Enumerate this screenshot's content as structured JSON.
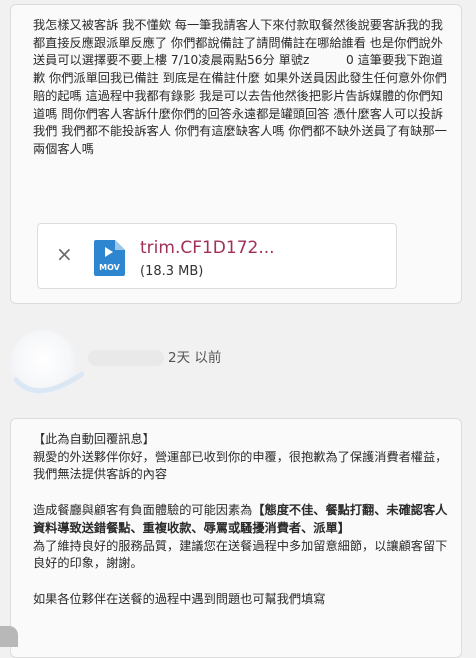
{
  "message": {
    "body": "我怎樣又被客訴 我不懂欸 每一筆我請客人下來付款取餐然後說要客訴我的我都直接反應跟派單反應了 你們都說備註了請問備註在哪給誰看 也是你們說外送員可以選擇要不要上樓 7/10凌晨兩點56分 單號z　　　0 這筆要我下跑道歉 你們派單回我已備註 到底是在備註什麼 如果外送員因此發生任何意外你們賠的起嗎 這過程中我都有錄影 我是可以去告他然後把影片告訴媒體的你們知道嗎 問你們客人客訴什麼你們的回答永遠都是罐頭回答 憑什麼客人可以投訴我們 我們都不能投訴客人 你們有這麼缺客人嗎 你們都不缺外送員了有缺那一兩個客人嗎"
  },
  "attachment": {
    "remove_glyph": "×",
    "file_icon_label": "MOV",
    "file_name": "trim.CF1D172...",
    "file_size": "(18.3 MB)"
  },
  "reply": {
    "time": "2天 以前",
    "auto_reply_tag": "【此為自動回覆訊息】",
    "greeting": "親愛的外送夥伴你好，營運部已收到你的申覆，很抱歉為了保護消費者權益，我們無法提供客訴的內容",
    "factors_intro": "造成餐廳與顧客有負面體驗的可能因素為",
    "factors": "【態度不佳、餐點打翻、未確認客人資料導致送錯餐點、重複收款、辱罵或騷擾消費者、派單】",
    "advice": "為了維持良好的服務品質，建議您在送餐過程中多加留意細節，以讓顧客留下良好的印象，謝謝。",
    "footer": "如果各位夥伴在送餐的過程中遇到問題也可幫我們填寫"
  },
  "colors": {
    "background": "#f1f1f1",
    "card": "#fafafa",
    "file_name_link": "#a0305a",
    "mov_icon": "#2f86d0"
  }
}
